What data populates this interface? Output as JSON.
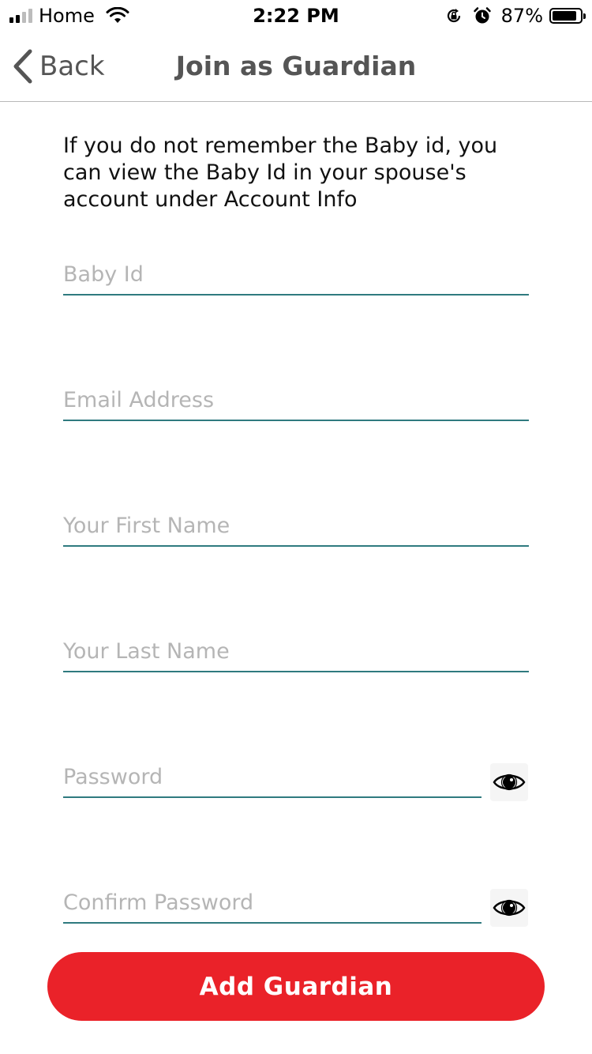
{
  "status_bar": {
    "carrier": "Home",
    "time": "2:22 PM",
    "battery_percent": "87%",
    "battery_level": 0.87,
    "icons": [
      "signal-icon",
      "wifi-icon",
      "orientation-lock-icon",
      "alarm-icon",
      "battery-icon"
    ]
  },
  "nav": {
    "back_label": "Back",
    "title": "Join as Guardian",
    "back_icon": "chevron-left-icon"
  },
  "info_text": "If you do not remember the Baby id, you can view the Baby Id in your spouse's account under Account Info",
  "fields": {
    "baby_id": {
      "placeholder": "Baby Id",
      "value": ""
    },
    "email": {
      "placeholder": "Email Address",
      "value": ""
    },
    "first_name": {
      "placeholder": "Your First Name",
      "value": ""
    },
    "last_name": {
      "placeholder": "Your Last Name",
      "value": ""
    },
    "password": {
      "placeholder": "Password",
      "value": "",
      "toggle_icon": "eye-icon"
    },
    "confirm_password": {
      "placeholder": "Confirm Password",
      "value": "",
      "toggle_icon": "eye-icon"
    }
  },
  "submit_label": "Add Guardian",
  "colors": {
    "accent": "#ea2229",
    "field_underline": "#2f7a7f",
    "placeholder": "#b5b5b5",
    "nav_text": "#555555"
  }
}
